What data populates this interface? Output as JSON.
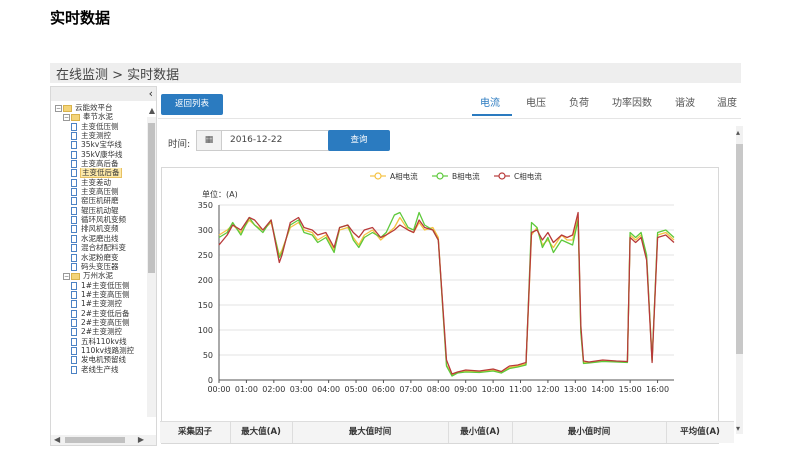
{
  "doc_heading": "实时数据",
  "breadcrumb": "在线监测 > 实时数据",
  "sidebar": {
    "collapse_icon": "‹",
    "items": [
      {
        "label": "云能效平台",
        "kind": "folder",
        "level": 0
      },
      {
        "label": "奉节水泥",
        "kind": "folder",
        "level": 1
      },
      {
        "label": "主变低压侧",
        "kind": "file",
        "level": 2
      },
      {
        "label": "主变测控",
        "kind": "file",
        "level": 2
      },
      {
        "label": "35kv宝华线",
        "kind": "file",
        "level": 2
      },
      {
        "label": "35kV康华线",
        "kind": "file",
        "level": 2
      },
      {
        "label": "主变高后备",
        "kind": "file",
        "level": 2
      },
      {
        "label": "主变低后备",
        "kind": "file",
        "level": 2,
        "selected": true
      },
      {
        "label": "主变差动",
        "kind": "file",
        "level": 2
      },
      {
        "label": "主变高压侧",
        "kind": "file",
        "level": 2
      },
      {
        "label": "窑压机研磨",
        "kind": "file",
        "level": 2
      },
      {
        "label": "辊压机动辊",
        "kind": "file",
        "level": 2
      },
      {
        "label": "循环风机变频",
        "kind": "file",
        "level": 2
      },
      {
        "label": "排风机变频",
        "kind": "file",
        "level": 2
      },
      {
        "label": "水泥磨出线",
        "kind": "file",
        "level": 2
      },
      {
        "label": "混合材配料变",
        "kind": "file",
        "level": 2
      },
      {
        "label": "水泥粉磨变",
        "kind": "file",
        "level": 2
      },
      {
        "label": "码头变压器",
        "kind": "file",
        "level": 2
      },
      {
        "label": "万州水泥",
        "kind": "folder",
        "level": 1
      },
      {
        "label": "1#主变低压侧",
        "kind": "file",
        "level": 2
      },
      {
        "label": "1#主变高压侧",
        "kind": "file",
        "level": 2
      },
      {
        "label": "1#主变测控",
        "kind": "file",
        "level": 2
      },
      {
        "label": "2#主变低后备",
        "kind": "file",
        "level": 2
      },
      {
        "label": "2#主变高压侧",
        "kind": "file",
        "level": 2
      },
      {
        "label": "2#主变测控",
        "kind": "file",
        "level": 2
      },
      {
        "label": "五科110kv线",
        "kind": "file",
        "level": 2
      },
      {
        "label": "110kv线路测控",
        "kind": "file",
        "level": 2
      },
      {
        "label": "发电机预留线",
        "kind": "file",
        "level": 2
      },
      {
        "label": "老线生产线",
        "kind": "file",
        "level": 2
      }
    ]
  },
  "toolbar": {
    "back_label": "返回列表",
    "time_label": "时间:",
    "date_value": "2016-12-22",
    "query_label": "查询",
    "calendar_icon": "calendar-icon"
  },
  "tabs": [
    {
      "label": "电流",
      "active": true
    },
    {
      "label": "电压",
      "active": false
    },
    {
      "label": "负荷",
      "active": false
    },
    {
      "label": "功率因数",
      "active": false
    },
    {
      "label": "谐波",
      "active": false
    },
    {
      "label": "温度",
      "active": false
    }
  ],
  "table": {
    "headers": [
      "采集因子",
      "最大值(A)",
      "最大值时间",
      "最小值(A)",
      "最小值时间",
      "平均值(A)"
    ]
  },
  "chart_data": {
    "type": "line",
    "unit_label": "单位：(A)",
    "ylim": [
      0,
      350
    ],
    "yticks": [
      0,
      50,
      100,
      150,
      200,
      250,
      300,
      350
    ],
    "xlim": [
      0,
      16.6
    ],
    "xticks": [
      "00:00",
      "01:00",
      "02:00",
      "03:00",
      "04:00",
      "05:00",
      "06:00",
      "07:00",
      "08:00",
      "09:00",
      "10:00",
      "11:00",
      "12:00",
      "13:00",
      "14:00",
      "15:00",
      "16:00"
    ],
    "grid": true,
    "legend_position": "top-center",
    "colors": {
      "A": "#f5c242",
      "B": "#5ec93c",
      "C": "#b83a3a"
    },
    "series": [
      {
        "name": "A相电流",
        "key": "A",
        "x": [
          0,
          0.3,
          0.5,
          0.8,
          1.1,
          1.3,
          1.6,
          1.9,
          2.2,
          2.3,
          2.6,
          2.9,
          3.1,
          3.4,
          3.6,
          3.9,
          4.2,
          4.4,
          4.7,
          4.9,
          5.1,
          5.3,
          5.6,
          5.9,
          6.1,
          6.4,
          6.6,
          6.9,
          7.1,
          7.3,
          7.5,
          7.8,
          8.0,
          8.3,
          8.5,
          8.7,
          9.0,
          9.5,
          10.0,
          10.3,
          10.6,
          10.9,
          11.2,
          11.4,
          11.6,
          11.8,
          12.0,
          12.2,
          12.5,
          12.7,
          12.9,
          13.1,
          13.2,
          13.3,
          13.5,
          14.0,
          14.5,
          14.9,
          15.0,
          15.2,
          15.4,
          15.6,
          15.8,
          16.0,
          16.3,
          16.6
        ],
        "y": [
          290,
          300,
          310,
          295,
          320,
          310,
          300,
          315,
          250,
          260,
          305,
          315,
          300,
          295,
          280,
          290,
          260,
          300,
          305,
          285,
          270,
          290,
          300,
          280,
          290,
          305,
          325,
          300,
          295,
          315,
          300,
          305,
          285,
          30,
          10,
          15,
          18,
          17,
          20,
          15,
          25,
          28,
          32,
          290,
          305,
          270,
          280,
          265,
          290,
          280,
          280,
          325,
          100,
          35,
          35,
          38,
          37,
          36,
          290,
          280,
          290,
          245,
          40,
          290,
          295,
          280
        ]
      },
      {
        "name": "B相电流",
        "key": "B",
        "x": [
          0,
          0.3,
          0.5,
          0.8,
          1.1,
          1.3,
          1.6,
          1.9,
          2.2,
          2.3,
          2.6,
          2.9,
          3.1,
          3.4,
          3.6,
          3.9,
          4.2,
          4.4,
          4.7,
          4.9,
          5.1,
          5.3,
          5.6,
          5.9,
          6.1,
          6.4,
          6.6,
          6.9,
          7.1,
          7.3,
          7.5,
          7.8,
          8.0,
          8.3,
          8.5,
          8.7,
          9.0,
          9.5,
          10.0,
          10.3,
          10.6,
          10.9,
          11.2,
          11.4,
          11.6,
          11.8,
          12.0,
          12.2,
          12.5,
          12.7,
          12.9,
          13.1,
          13.2,
          13.3,
          13.5,
          14.0,
          14.5,
          14.9,
          15.0,
          15.2,
          15.4,
          15.6,
          15.8,
          16.0,
          16.3,
          16.6
        ],
        "y": [
          285,
          295,
          315,
          290,
          325,
          310,
          295,
          320,
          245,
          255,
          310,
          320,
          295,
          290,
          275,
          285,
          255,
          305,
          310,
          280,
          265,
          285,
          295,
          285,
          295,
          330,
          335,
          305,
          300,
          335,
          310,
          300,
          280,
          28,
          8,
          14,
          16,
          15,
          18,
          14,
          23,
          26,
          30,
          315,
          305,
          265,
          285,
          255,
          280,
          275,
          270,
          320,
          95,
          33,
          34,
          37,
          36,
          35,
          295,
          285,
          295,
          250,
          38,
          295,
          300,
          285
        ]
      },
      {
        "name": "C相电流",
        "key": "C",
        "x": [
          0,
          0.3,
          0.5,
          0.8,
          1.1,
          1.3,
          1.6,
          1.9,
          2.2,
          2.3,
          2.6,
          2.9,
          3.1,
          3.4,
          3.6,
          3.9,
          4.2,
          4.4,
          4.7,
          4.9,
          5.1,
          5.3,
          5.6,
          5.9,
          6.1,
          6.4,
          6.6,
          6.9,
          7.1,
          7.3,
          7.5,
          7.8,
          8.0,
          8.3,
          8.5,
          8.7,
          9.0,
          9.5,
          10.0,
          10.3,
          10.6,
          10.9,
          11.2,
          11.4,
          11.6,
          11.8,
          12.0,
          12.2,
          12.5,
          12.7,
          12.9,
          13.1,
          13.2,
          13.3,
          13.5,
          14.0,
          14.5,
          14.9,
          15.0,
          15.2,
          15.4,
          15.6,
          15.8,
          16.0,
          16.3,
          16.6
        ],
        "y": [
          270,
          290,
          310,
          300,
          325,
          320,
          300,
          320,
          235,
          250,
          315,
          325,
          305,
          300,
          290,
          295,
          265,
          305,
          310,
          295,
          285,
          300,
          305,
          285,
          290,
          300,
          310,
          300,
          295,
          320,
          305,
          300,
          280,
          40,
          12,
          16,
          20,
          18,
          22,
          17,
          28,
          30,
          35,
          295,
          300,
          280,
          295,
          275,
          290,
          285,
          290,
          335,
          110,
          38,
          36,
          40,
          38,
          37,
          285,
          275,
          285,
          240,
          35,
          285,
          290,
          275
        ]
      }
    ]
  }
}
